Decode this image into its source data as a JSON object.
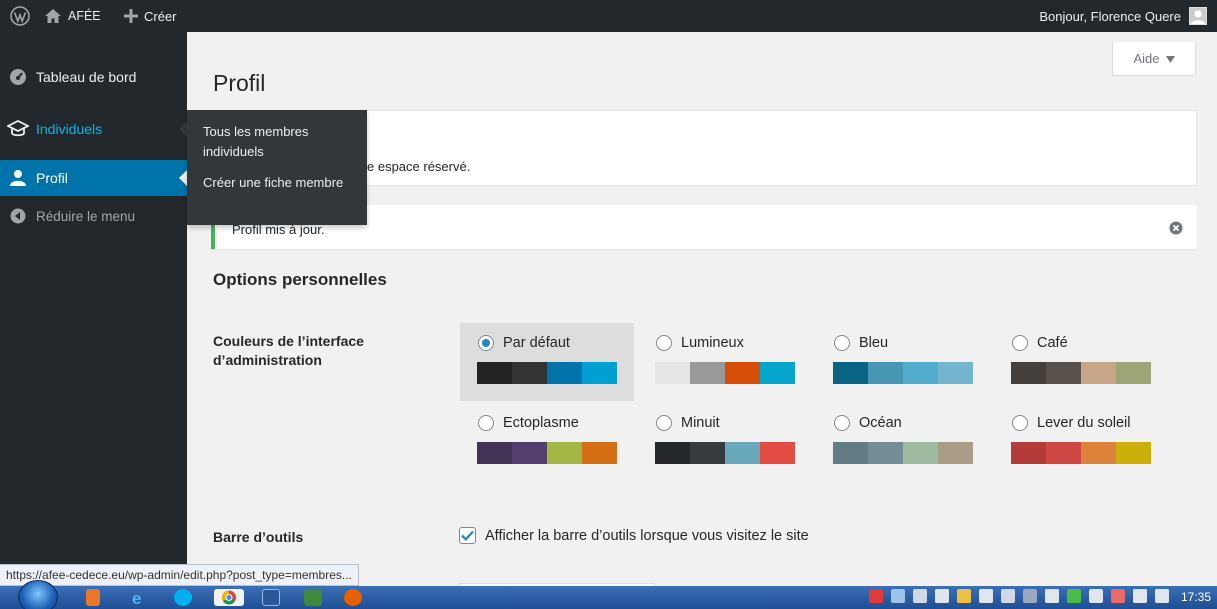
{
  "adminbar": {
    "site_name": "AFÉE",
    "create_label": "Créer",
    "greeting": "Bonjour, Florence Quere"
  },
  "sidebar": {
    "items": [
      {
        "label": "Tableau de bord",
        "icon": "dashboard-icon"
      },
      {
        "label": "Individuels",
        "icon": "graduation-cap-icon"
      },
      {
        "label": "Profil",
        "icon": "user-icon"
      },
      {
        "label": "Réduire le menu",
        "icon": "collapse-arrow-icon"
      }
    ]
  },
  "flyout": {
    "links": [
      "Tous les membres individuels",
      "Créer une fiche membre"
    ]
  },
  "help_tab": "Aide",
  "page_title": "Profil",
  "info_text": "e espace réservé.",
  "notice_text": "Profil mis à jour.",
  "section_title": "Options personnelles",
  "color_scheme": {
    "label": "Couleurs de l’interface d’administration",
    "options": [
      {
        "name": "Par défaut",
        "selected": true,
        "colors": [
          "#222222",
          "#333333",
          "#0073aa",
          "#00a0d2"
        ]
      },
      {
        "name": "Lumineux",
        "selected": false,
        "colors": [
          "#e5e5e5",
          "#999999",
          "#d64e07",
          "#04a4cc"
        ]
      },
      {
        "name": "Bleu",
        "selected": false,
        "colors": [
          "#096484",
          "#4796b3",
          "#52accc",
          "#74b6ce"
        ]
      },
      {
        "name": "Café",
        "selected": false,
        "colors": [
          "#46403c",
          "#59524c",
          "#c7a589",
          "#9ea476"
        ]
      },
      {
        "name": "Ectoplasme",
        "selected": false,
        "colors": [
          "#413256",
          "#523f6d",
          "#a3b745",
          "#d46f15"
        ]
      },
      {
        "name": "Minuit",
        "selected": false,
        "colors": [
          "#25282b",
          "#363b3f",
          "#69a8bb",
          "#e14d43"
        ]
      },
      {
        "name": "Océan",
        "selected": false,
        "colors": [
          "#627c83",
          "#738e96",
          "#9ebaa0",
          "#aa9d88"
        ]
      },
      {
        "name": "Lever du soleil",
        "selected": false,
        "colors": [
          "#b43c38",
          "#cf4944",
          "#dd823b",
          "#ccaf0b"
        ]
      }
    ]
  },
  "toolbar": {
    "label": "Barre d’outils",
    "checkbox_label": "Afficher la barre d’outils lorsque vous visitez le site",
    "checked": true
  },
  "status_url": "https://afee-cedece.eu/wp-admin/edit.php?post_type=membres...",
  "taskbar": {
    "clock": "17:35"
  }
}
